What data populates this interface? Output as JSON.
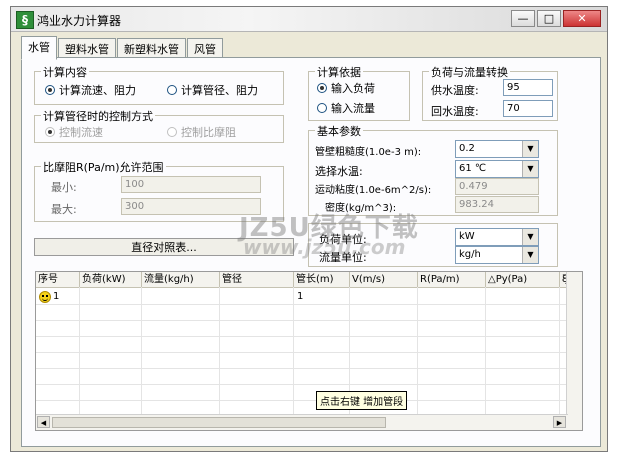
{
  "app": {
    "title": "鸿业水力计算器",
    "icon_glyph": "§",
    "window_buttons": {
      "minimize": "—",
      "maximize": "□",
      "close": "✕"
    }
  },
  "tabs": [
    {
      "label": "水管"
    },
    {
      "label": "塑料水管"
    },
    {
      "label": "新塑料水管"
    },
    {
      "label": "风管"
    }
  ],
  "calc_content": {
    "title": "计算内容",
    "option1": "计算流速、阻力",
    "option2": "计算管径、阻力",
    "selected": "option1"
  },
  "control_mode": {
    "title": "计算管径时的控制方式",
    "option1": "控制流速",
    "option2": "控制比摩阻"
  },
  "friction_range": {
    "title": "比摩阻R(Pa/m)允许范围",
    "min_label": "最小:",
    "min_value": "100",
    "max_label": "最大:",
    "max_value": "300"
  },
  "diameter_button": "直径对照表...",
  "calc_basis": {
    "title": "计算依据",
    "option1": "输入负荷",
    "option2": "输入流量",
    "selected": "option1"
  },
  "load_flow": {
    "title": "负荷与流量转换",
    "supply_label": "供水温度:",
    "supply_value": "95",
    "return_label": "回水温度:",
    "return_value": "70"
  },
  "basic_params": {
    "title": "基本参数",
    "roughness_label": "管壁粗糙度(1.0e-3 m):",
    "roughness_value": "0.2",
    "water_temp_label": "选择水温:",
    "water_temp_value": "61  ℃",
    "viscosity_label": "运动粘度(1.0e-6m^2/s):",
    "viscosity_value": "0.479",
    "density_label": "密度(kg/m^3):",
    "density_value": "983.24"
  },
  "units": {
    "load_label": "负荷单位:",
    "load_value": "kW",
    "flow_label": "流量单位:",
    "flow_value": "kg/h"
  },
  "table": {
    "columns": [
      "序号",
      "负荷(kW)",
      "流量(kg/h)",
      "管径",
      "管长(m)",
      "V(m/s)",
      "R(Pa/m)",
      "△Py(Pa)",
      "ξ"
    ],
    "rows": [
      {
        "index": "1",
        "load": "",
        "flow": "",
        "diameter": "",
        "length": "1",
        "v": "",
        "r": "",
        "dpy": "",
        "xi": ""
      }
    ]
  },
  "tooltip": "点击右键 增加管段",
  "watermark": {
    "line1": "JZ5U绿色下载",
    "line2": "www.jz5u.com"
  },
  "icons": {
    "row_status": "smiley-icon"
  }
}
